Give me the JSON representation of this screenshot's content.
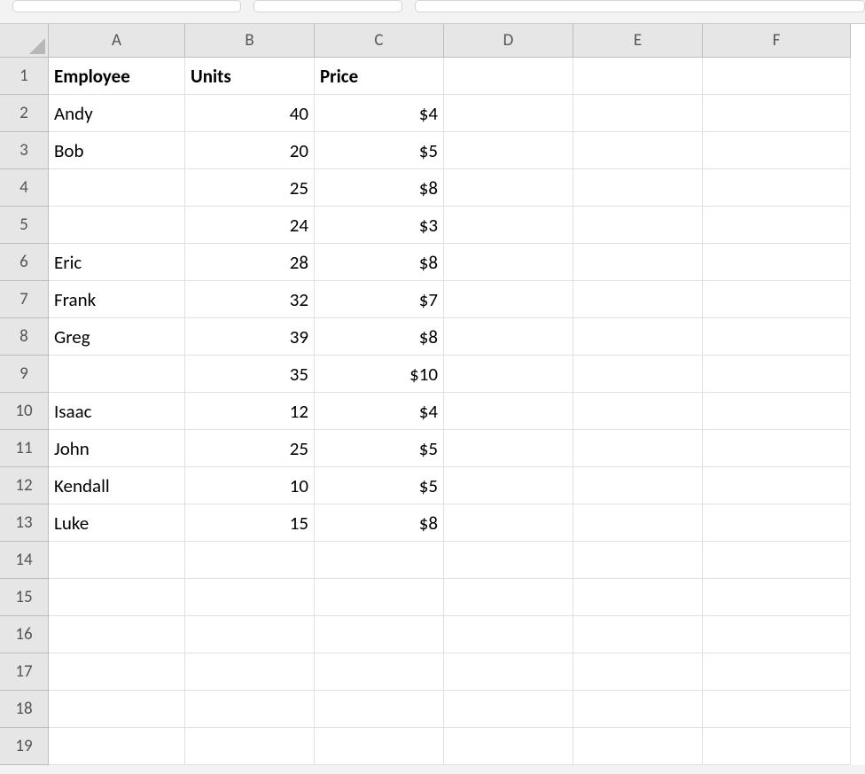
{
  "columns": [
    "A",
    "B",
    "C",
    "D",
    "E",
    "F"
  ],
  "rowNumbers": [
    "1",
    "2",
    "3",
    "4",
    "5",
    "6",
    "7",
    "8",
    "9",
    "10",
    "11",
    "12",
    "13",
    "14",
    "15",
    "16",
    "17",
    "18",
    "19"
  ],
  "headers": {
    "employee": "Employee",
    "units": "Units",
    "price": "Price"
  },
  "rows": [
    {
      "employee": "Andy",
      "units": "40",
      "price": "$4"
    },
    {
      "employee": "Bob",
      "units": "20",
      "price": "$5"
    },
    {
      "employee": "",
      "units": "25",
      "price": "$8"
    },
    {
      "employee": "",
      "units": "24",
      "price": "$3"
    },
    {
      "employee": "Eric",
      "units": "28",
      "price": "$8"
    },
    {
      "employee": "Frank",
      "units": "32",
      "price": "$7"
    },
    {
      "employee": "Greg",
      "units": "39",
      "price": "$8"
    },
    {
      "employee": "",
      "units": "35",
      "price": "$10"
    },
    {
      "employee": "Isaac",
      "units": "12",
      "price": "$4"
    },
    {
      "employee": "John",
      "units": "25",
      "price": "$5"
    },
    {
      "employee": "Kendall",
      "units": "10",
      "price": "$5"
    },
    {
      "employee": "Luke",
      "units": "15",
      "price": "$8"
    }
  ]
}
